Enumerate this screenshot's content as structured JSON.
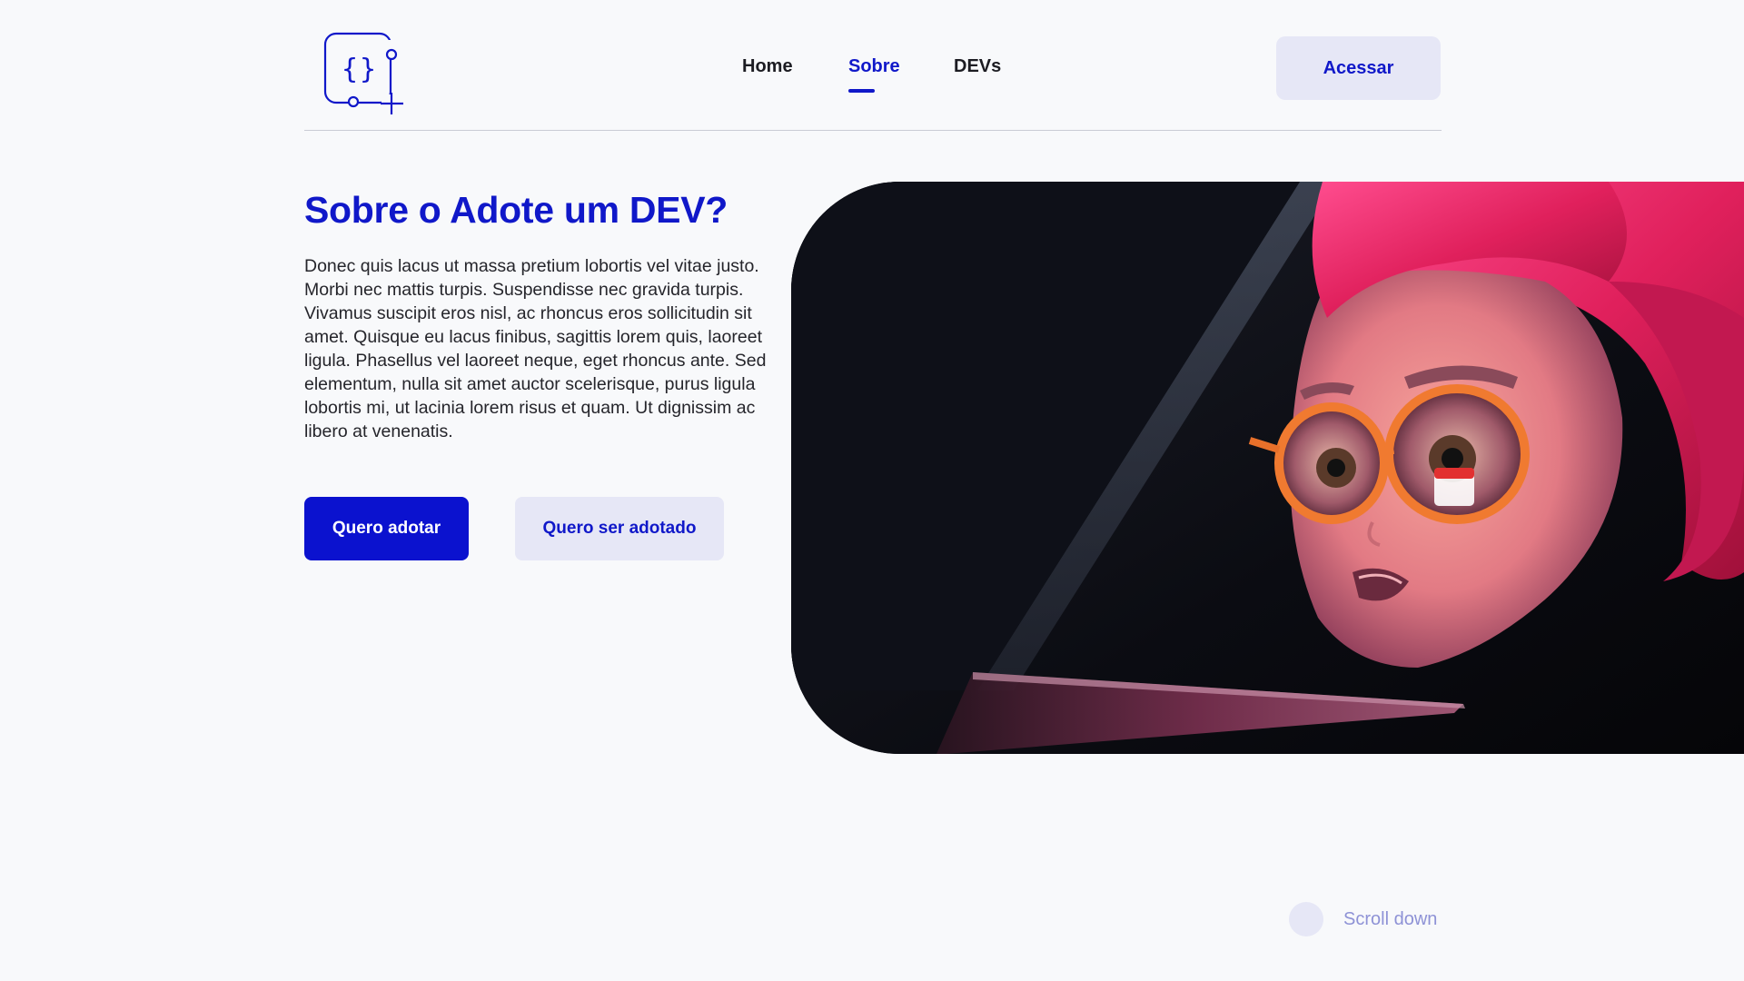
{
  "header": {
    "logo_icon": "code-braces-plus-icon",
    "nav": [
      {
        "label": "Home"
      },
      {
        "label": "Sobre",
        "active": true
      },
      {
        "label": "DEVs"
      }
    ],
    "login_label": "Acessar"
  },
  "hero": {
    "title": "Sobre o Adote um DEV?",
    "paragraph": "Donec quis lacus ut massa pretium lobortis vel vitae justo. Morbi nec mattis turpis. Suspendisse nec gravida turpis. Vivamus suscipit eros nisl, ac rhoncus eros sollicitudin sit amet. Quisque eu lacus finibus, sagittis lorem quis, laoreet ligula. Phasellus vel laoreet neque, eget rhoncus ante. Sed elementum, nulla sit amet auctor scelerisque, purus ligula lobortis mi, ut lacinia lorem risus et quam. Ut dignissim ac libero at venenatis.",
    "primary_button": "Quero adotar",
    "secondary_button": "Quero ser adotado",
    "image": "memoji-girl-glasses-laptop"
  },
  "footer": {
    "scroll_label": "Scroll down"
  },
  "colors": {
    "accent": "#1018c9",
    "primary_button": "#0b12cf",
    "soft_button": "#e6e7f6",
    "background": "#f8f9fb",
    "scroll_text": "#8e92d6"
  }
}
